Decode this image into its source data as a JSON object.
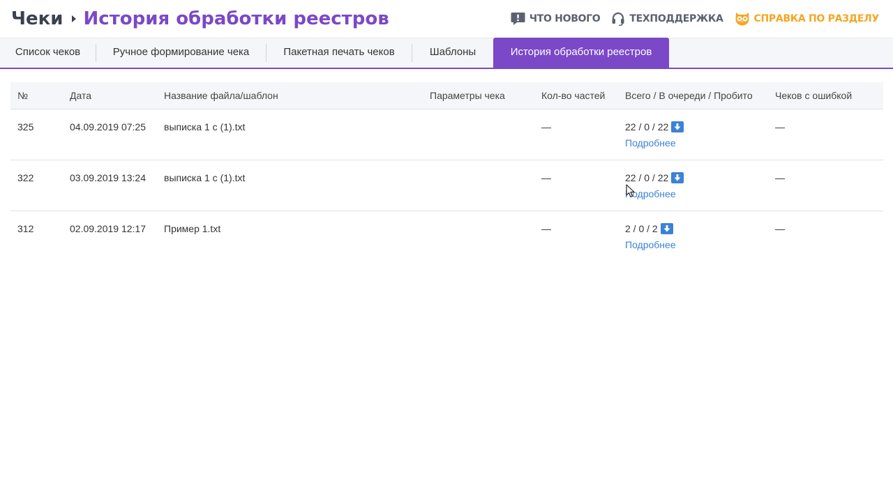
{
  "breadcrumb": {
    "root": "Чеки",
    "current": "История обработки реестров"
  },
  "top_links": {
    "whats_new": "Что нового",
    "support": "Техподдержка",
    "help": "Справка по разделу"
  },
  "colors": {
    "accent": "#7b48c8",
    "link": "#3b82d6",
    "help": "#f5a623"
  },
  "tabs": [
    {
      "label": "Список чеков"
    },
    {
      "label": "Ручное формирование чека"
    },
    {
      "label": "Пакетная печать чеков"
    },
    {
      "label": "Шаблоны"
    },
    {
      "label": "История обработки реестров",
      "active": true
    }
  ],
  "table": {
    "columns": [
      "№",
      "Дата",
      "Название файла/шаблон",
      "Параметры чека",
      "Кол-во частей",
      "Всего / В очереди / Пробито",
      "Чеков с ошибкой"
    ],
    "details_label": "Подробнее",
    "rows": [
      {
        "num": "325",
        "date": "04.09.2019 07:25",
        "file": "выписка 1 с (1).txt",
        "params": "",
        "parts": "—",
        "counts": "22 / 0 / 22",
        "errors": "—"
      },
      {
        "num": "322",
        "date": "03.09.2019 13:24",
        "file": "выписка 1 с (1).txt",
        "params": "",
        "parts": "—",
        "counts": "22 / 0 / 22",
        "errors": "—"
      },
      {
        "num": "312",
        "date": "02.09.2019 12:17",
        "file": "Пример 1.txt",
        "params": "",
        "parts": "—",
        "counts": "2 / 0 / 2",
        "errors": "—"
      }
    ]
  }
}
